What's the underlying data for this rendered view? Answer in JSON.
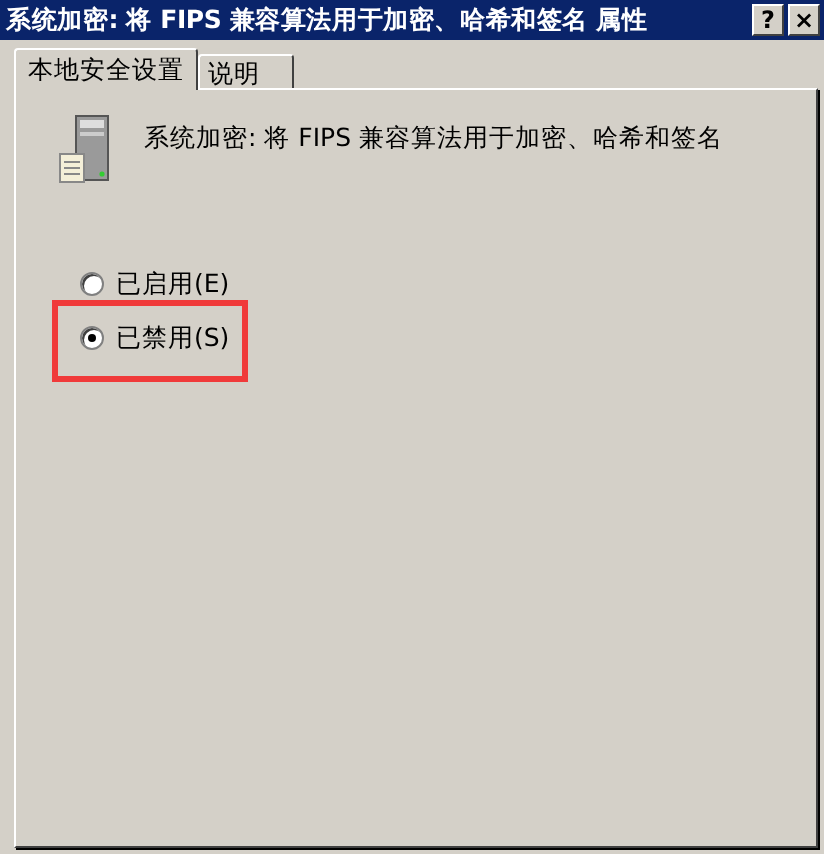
{
  "window": {
    "title": "系统加密: 将 FIPS 兼容算法用于加密、哈希和签名 属性",
    "buttons": [
      "?",
      "×"
    ]
  },
  "tabs": [
    {
      "label": "本地安全设置",
      "selected": true
    },
    {
      "label": "说明",
      "selected": false
    }
  ],
  "policy": {
    "name": "系统加密: 将 FIPS 兼容算法用于加密、哈希和签名"
  },
  "options": [
    {
      "label": "已启用(E)",
      "selected": false,
      "highlighted": false
    },
    {
      "label": "已禁用(S)",
      "selected": true,
      "highlighted": true
    }
  ]
}
